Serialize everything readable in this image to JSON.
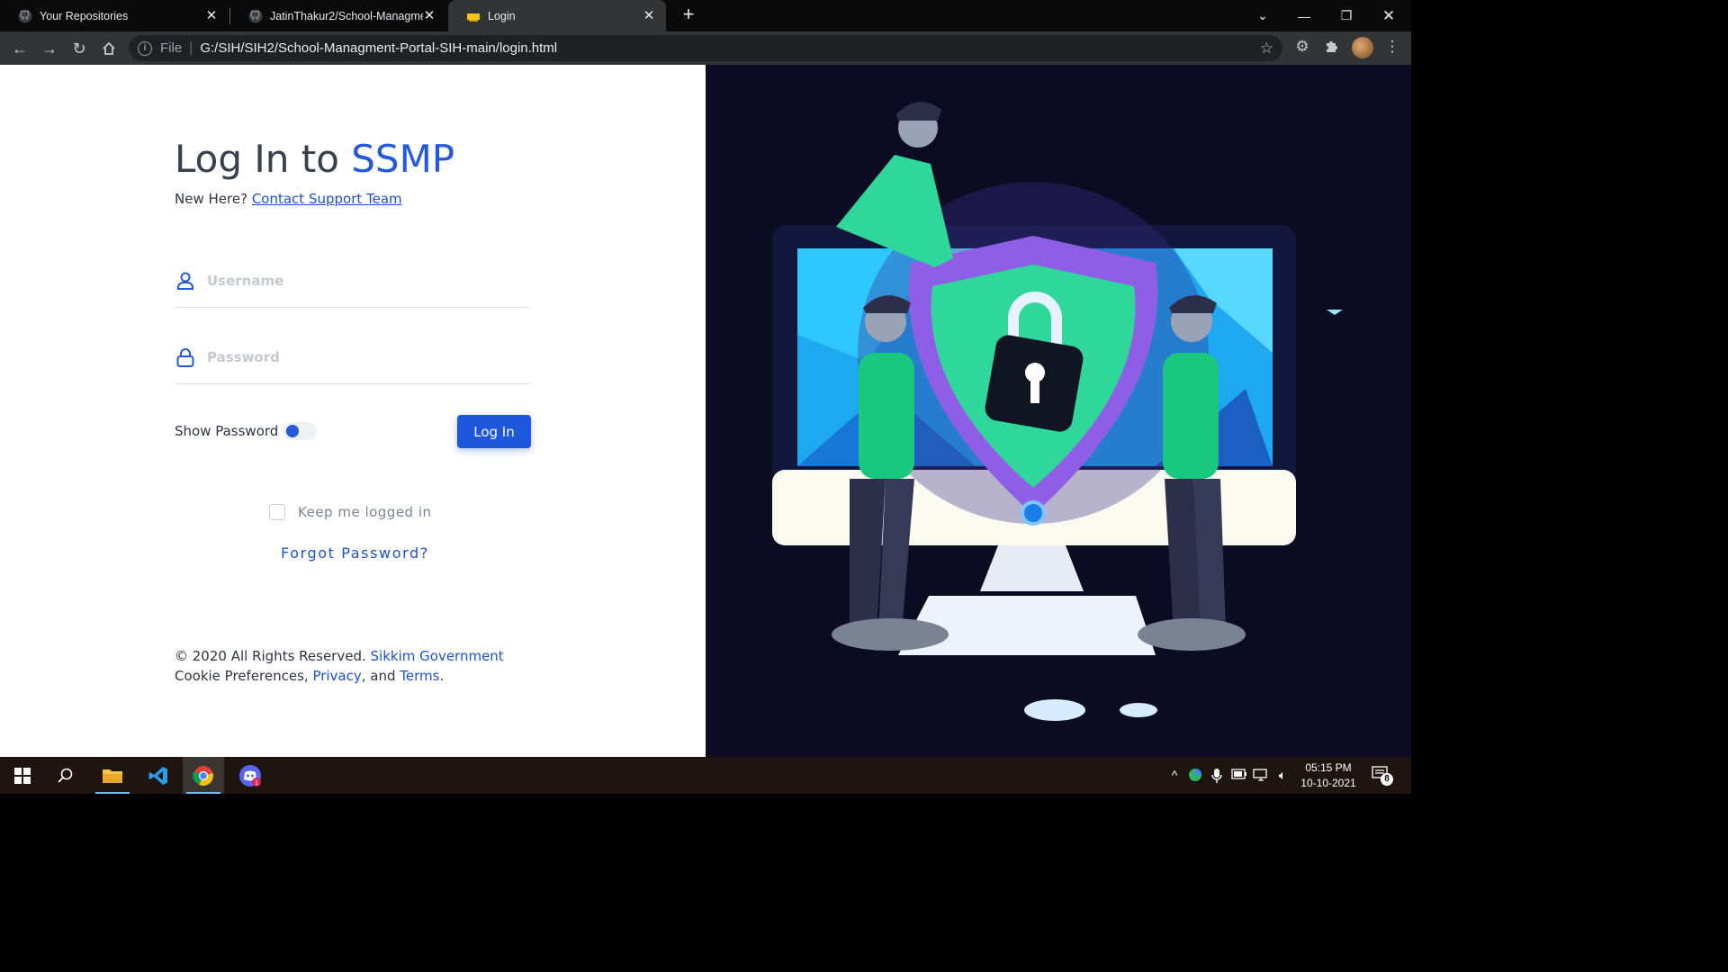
{
  "browser": {
    "tabs": [
      {
        "title": "Your Repositories",
        "icon": "github-icon"
      },
      {
        "title": "JatinThakur2/School-Managment",
        "icon": "github-icon"
      },
      {
        "title": "Login",
        "icon": "ssmp-favicon"
      }
    ],
    "new_tab": "+",
    "address": {
      "scheme_label": "File",
      "url": "G:/SIH/SIH2/School-Managment-Portal-SIH-main/login.html"
    }
  },
  "login": {
    "heading_prefix": "Log In to ",
    "brand": "SSMP",
    "new_here": "New Here?",
    "contact_link": "Contact Support Team",
    "username_placeholder": "Username",
    "password_placeholder": "Password",
    "show_password_label": "Show Password",
    "show_password_on": true,
    "login_button": "Log In",
    "keep_logged_in": "Keep me logged in",
    "forgot_password": "Forgot Password?",
    "footer": {
      "copyright": "© 2020 All Rights Reserved.",
      "gov_link": "Sikkim Government",
      "cookie_text": " Cookie Preferences, ",
      "privacy_link": "Privacy",
      "and_text": ", and ",
      "terms_link": "Terms",
      "period": "."
    }
  },
  "taskbar": {
    "apps": [
      "start-icon",
      "search-icon",
      "file-explorer-icon",
      "vscode-icon",
      "chrome-icon",
      "discord-icon"
    ],
    "discord_badge": "1",
    "time": "05:15 PM",
    "date": "10-10-2021",
    "notification_count": "8"
  },
  "colors": {
    "brand_blue": "#2659d8",
    "button_blue": "#1e56dc",
    "illustration_bg": "#0b0c22"
  }
}
